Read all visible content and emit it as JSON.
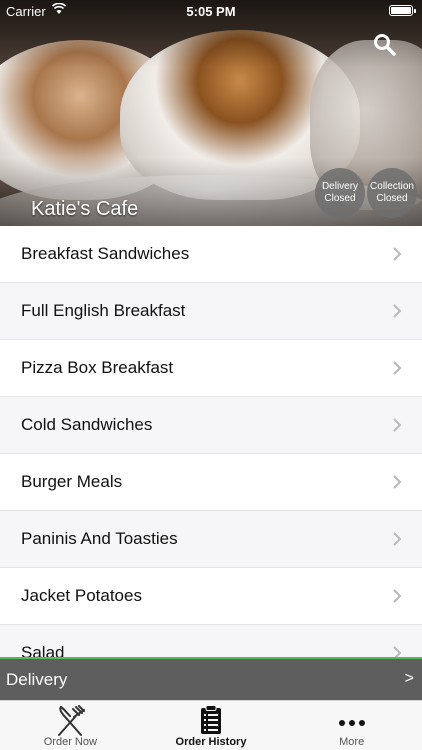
{
  "status_bar": {
    "carrier": "Carrier",
    "time": "5:05 PM"
  },
  "header": {
    "title": "Katie's Cafe",
    "delivery_badge": {
      "line1": "Delivery",
      "line2": "Closed"
    },
    "collection_badge": {
      "line1": "Collection",
      "line2": "Closed"
    },
    "search_icon": "search-icon"
  },
  "categories": [
    "Breakfast Sandwiches",
    "Full English Breakfast",
    "Pizza Box Breakfast",
    "Cold Sandwiches",
    "Burger Meals",
    "Paninis And Toasties",
    "Jacket Potatoes",
    "Salad"
  ],
  "delivery_bar": {
    "label": "Delivery",
    "arrow": ">"
  },
  "tabs": [
    {
      "label": "Order Now",
      "icon": "fork-knife-icon"
    },
    {
      "label": "Order History",
      "icon": "clipboard-icon"
    },
    {
      "label": "More",
      "icon": "more-dots-icon"
    }
  ],
  "colors": {
    "delivery_bar_bg": "#5e5e5e",
    "delivery_bar_accent": "#5cb85c",
    "tab_bar_bg": "#f7f7f7"
  }
}
